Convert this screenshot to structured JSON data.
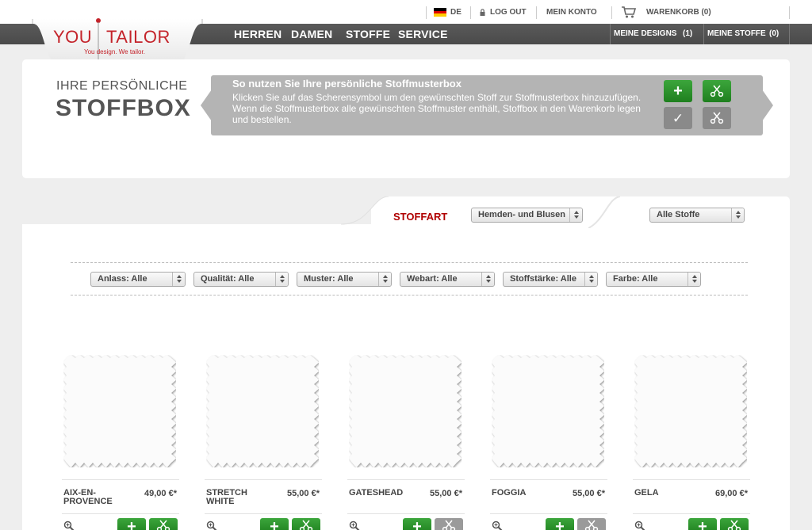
{
  "topbar": {
    "language": "DE",
    "logout": "LOG OUT",
    "account": "MEIN KONTO",
    "cart": "WARENKORB (0)"
  },
  "logo": {
    "word1": "YOU",
    "word2": "TAILOR",
    "tagline": "You design. We tailor."
  },
  "nav": {
    "items": [
      "HERREN",
      "DAMEN",
      "STOFFE",
      "SERVICE"
    ],
    "my_designs": "MEINE DESIGNS",
    "my_designs_count": "(1)",
    "my_fabrics": "MEINE STOFFE",
    "my_fabrics_count": "(0)"
  },
  "stoffbox": {
    "title_line1": "IHRE PERSÖNLICHE",
    "title_line2": "STOFFBOX",
    "info_title": "So nutzen Sie Ihre persönliche Stoffmusterbox",
    "info_text": "Klicken Sie auf das Scherensymbol um den gewünschten Stoff zur Stoffmusterbox hinzuzufügen. Wenn die Stoffmusterbox alle gewünschten Stoffmuster enthält, Stoffbox in den Warenkorb legen und bestellen."
  },
  "filters": {
    "stoffart_label": "STOFFART",
    "stoffart_value": "Hemden- und Blusen",
    "scope_value": "Alle Stoffe",
    "items": [
      "Anlass: Alle",
      "Qualität: Alle",
      "Muster: Alle",
      "Webart: Alle",
      "Stoffstärke: Alle",
      "Farbe: Alle"
    ]
  },
  "products": [
    {
      "name_line1": "AIX-EN-",
      "name_line2": "PROVENCE",
      "price": "49,00 €*",
      "swatch_added": true
    },
    {
      "name_line1": "STRETCH",
      "name_line2": "WHITE",
      "price": "55,00 €*",
      "swatch_added": true
    },
    {
      "name_line1": "GATESHEAD",
      "name_line2": "",
      "price": "55,00 €*",
      "swatch_added": false
    },
    {
      "name_line1": "FOGGIA",
      "name_line2": "",
      "price": "55,00 €*",
      "swatch_added": false
    },
    {
      "name_line1": "GELA",
      "name_line2": "",
      "price": "69,00 €*",
      "swatch_added": true
    }
  ],
  "colors": {
    "brand_red": "#c4242b",
    "nav_dark": "#4f4f4f",
    "action_green": "#2a962a",
    "stoffart_red": "#b00000"
  }
}
